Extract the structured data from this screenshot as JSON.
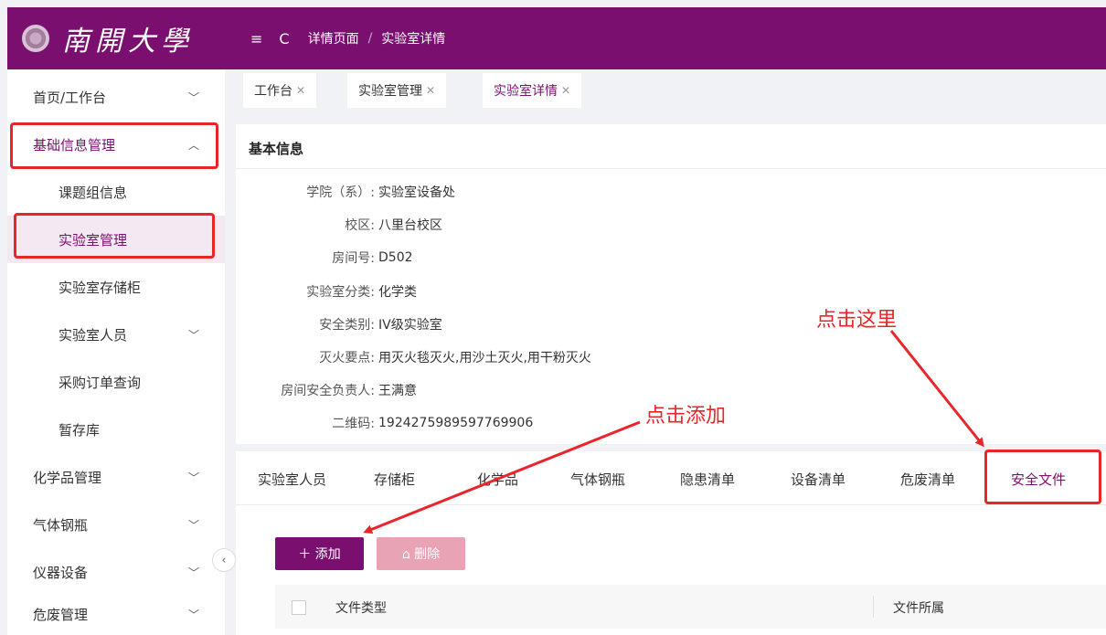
{
  "header": {
    "logo_text": "南開大學",
    "breadcrumb": [
      "详情页面",
      "实验室详情"
    ],
    "menu_toggle_icon": "≡",
    "refresh_icon": "C",
    "separator": "/"
  },
  "sidebar": {
    "items": [
      {
        "label": "首页/工作台",
        "expandable": true
      },
      {
        "label": "基础信息管理",
        "expanded": true
      },
      {
        "label": "课题组信息"
      },
      {
        "label": "实验室管理",
        "active": true
      },
      {
        "label": "实验室存储柜"
      },
      {
        "label": "实验室人员",
        "expandable": true
      },
      {
        "label": "采购订单查询"
      },
      {
        "label": "暂存库"
      },
      {
        "label": "化学品管理",
        "expandable": true
      },
      {
        "label": "气体钢瓶",
        "expandable": true
      },
      {
        "label": "仪器设备",
        "expandable": true
      },
      {
        "label": "危废管理",
        "expandable": true
      }
    ]
  },
  "tabs": [
    {
      "label": "工作台"
    },
    {
      "label": "实验室管理"
    },
    {
      "label": "实验室详情",
      "active": true
    }
  ],
  "info": {
    "title": "基本信息",
    "fields": [
      {
        "key": "学院（系）:",
        "value": "实验室设备处"
      },
      {
        "key": "校区:",
        "value": "八里台校区"
      },
      {
        "key": "房间号:",
        "value": "D502"
      },
      {
        "key": "实验室分类:",
        "value": "化学类"
      },
      {
        "key": "安全类别:",
        "value": "IV级实验室"
      },
      {
        "key": "灭火要点:",
        "value": "用灭火毯灭火,用沙土灭火,用干粉灭火"
      },
      {
        "key": "房间安全负责人:",
        "value": "王满意"
      },
      {
        "key": "二维码:",
        "value": "1924275989597769906"
      }
    ]
  },
  "subtabs": [
    "实验室人员",
    "存储柜",
    "化学品",
    "气体钢瓶",
    "隐患清单",
    "设备清单",
    "危废清单",
    "安全文件"
  ],
  "actions": {
    "add_label": "＋ 添加",
    "delete_label": "⌂ 删除"
  },
  "table": {
    "columns": [
      "文件类型",
      "文件所属"
    ]
  },
  "annotations": {
    "click_here": "点击这里",
    "click_add": "点击添加"
  },
  "colors": {
    "brand": "#7b0f6f",
    "annotation": "#e8262a",
    "delete_disabled": "#e8a3b4"
  }
}
